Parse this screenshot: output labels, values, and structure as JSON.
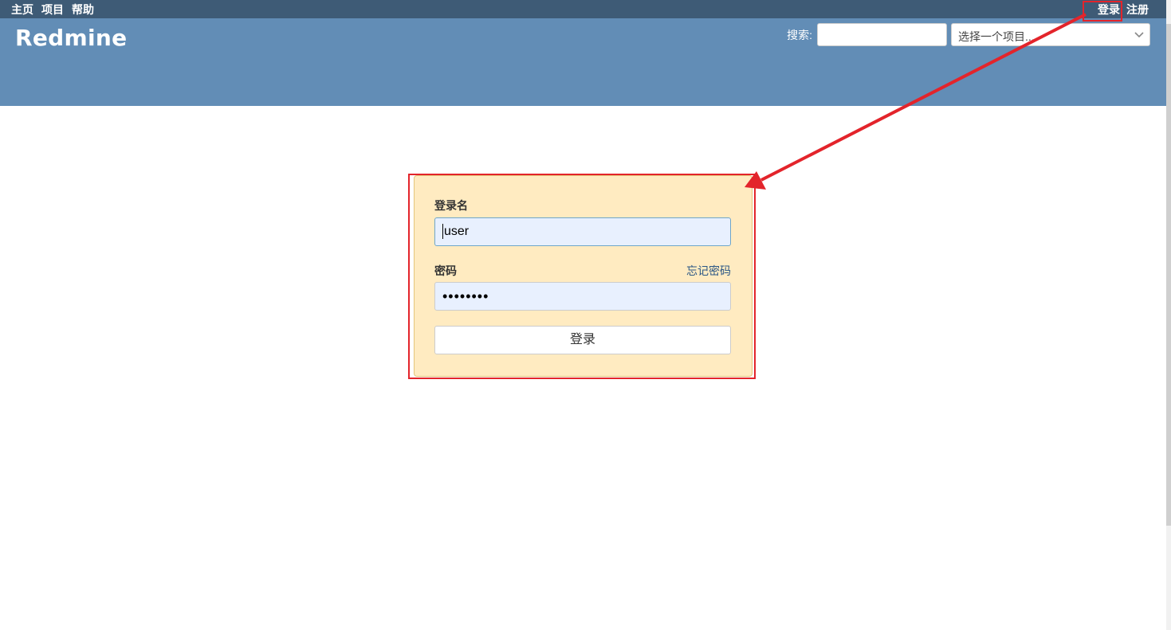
{
  "top_menu": {
    "home": "主页",
    "projects": "项目",
    "help": "帮助",
    "login": "登录",
    "register": "注册"
  },
  "header": {
    "title": "Redmine"
  },
  "search": {
    "label": "搜索:",
    "value": "",
    "project_jump": "选择一个项目..."
  },
  "login_form": {
    "username_label": "登录名",
    "username_value": "user",
    "password_label": "密码",
    "password_value": "••••••••",
    "lost_password": "忘记密码",
    "submit": "登录"
  },
  "annotation": {
    "color": "#e3242b"
  },
  "icons": {
    "select": "chevron-down-icon"
  }
}
